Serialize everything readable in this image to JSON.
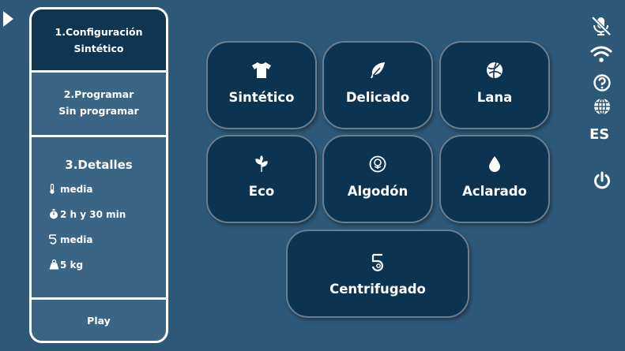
{
  "steps": {
    "configure": {
      "title": "1.Configuración",
      "value": "Sintético"
    },
    "program": {
      "title": "2.Programar",
      "value": "Sin programar"
    },
    "details": {
      "title": "3.Detalles",
      "temperature": "media",
      "duration": "2 h y 30 min",
      "spin": "media",
      "load": "5 kg"
    },
    "play_label": "Play"
  },
  "programs": [
    {
      "label": "Sintético",
      "icon": "tshirt-icon"
    },
    {
      "label": "Delicado",
      "icon": "feather-icon"
    },
    {
      "label": "Lana",
      "icon": "yarn-ball-icon"
    },
    {
      "label": "Eco",
      "icon": "leaf-icon"
    },
    {
      "label": "Algodón",
      "icon": "cotton-icon"
    },
    {
      "label": "Aclarado",
      "icon": "water-drop-icon"
    },
    {
      "label": "Centrifugado",
      "icon": "spin-speed-icon"
    }
  ],
  "sidebar_right": {
    "icons": [
      "mic-off-icon",
      "wifi-icon",
      "help-icon",
      "globe-icon",
      "power-icon"
    ],
    "language": "ES"
  },
  "colors": {
    "background": "#2e5878",
    "tile": "#0c3350",
    "selected_step": "#0f3551"
  }
}
